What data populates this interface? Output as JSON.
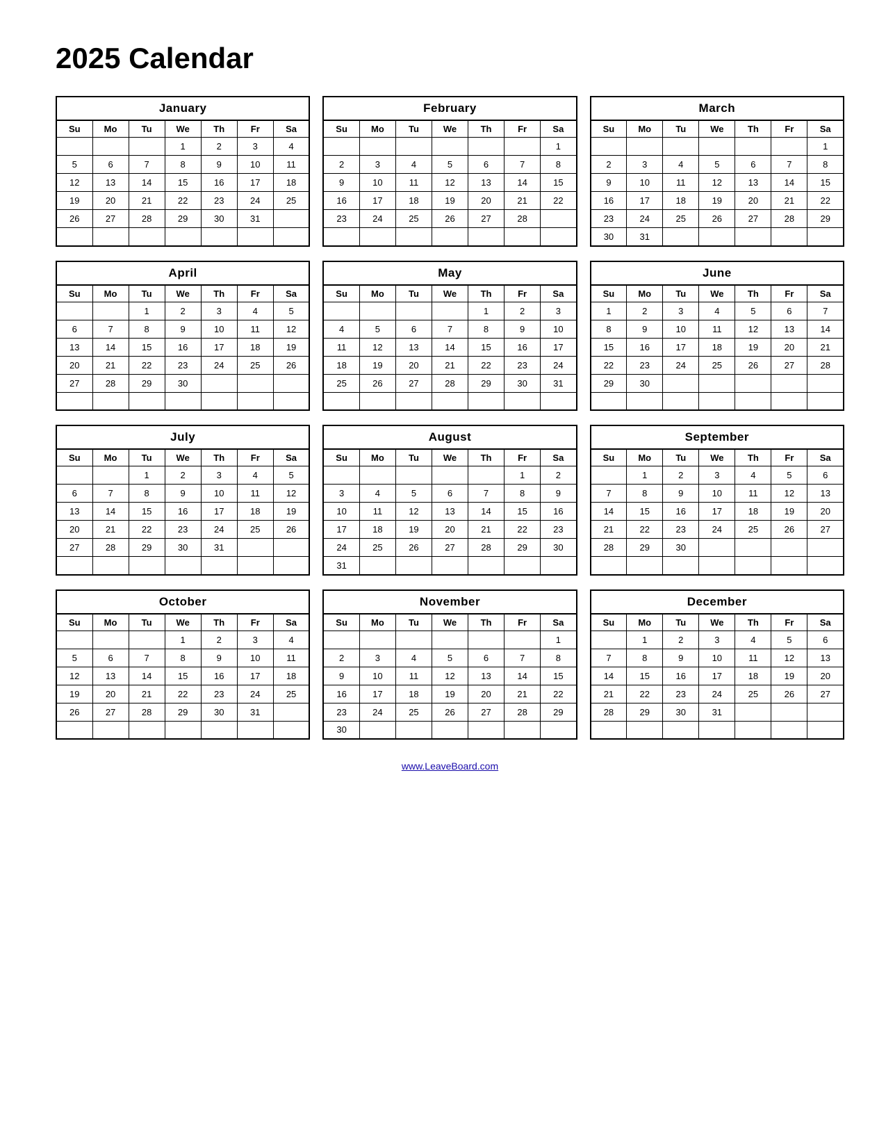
{
  "title": "2025 Calendar",
  "footer_link": "www.LeaveBoard.com",
  "days_header": [
    "Su",
    "Mo",
    "Tu",
    "We",
    "Th",
    "Fr",
    "Sa"
  ],
  "months": [
    {
      "name": "January",
      "weeks": [
        [
          "",
          "",
          "",
          "1",
          "2",
          "3",
          "4"
        ],
        [
          "5",
          "6",
          "7",
          "8",
          "9",
          "10",
          "11"
        ],
        [
          "12",
          "13",
          "14",
          "15",
          "16",
          "17",
          "18"
        ],
        [
          "19",
          "20",
          "21",
          "22",
          "23",
          "24",
          "25"
        ],
        [
          "26",
          "27",
          "28",
          "29",
          "30",
          "31",
          ""
        ],
        [
          "",
          "",
          "",
          "",
          "",
          "",
          ""
        ]
      ]
    },
    {
      "name": "February",
      "weeks": [
        [
          "",
          "",
          "",
          "",
          "",
          "",
          "1"
        ],
        [
          "2",
          "3",
          "4",
          "5",
          "6",
          "7",
          "8"
        ],
        [
          "9",
          "10",
          "11",
          "12",
          "13",
          "14",
          "15"
        ],
        [
          "16",
          "17",
          "18",
          "19",
          "20",
          "21",
          "22"
        ],
        [
          "23",
          "24",
          "25",
          "26",
          "27",
          "28",
          ""
        ],
        [
          "",
          "",
          "",
          "",
          "",
          "",
          ""
        ]
      ]
    },
    {
      "name": "March",
      "weeks": [
        [
          "",
          "",
          "",
          "",
          "",
          "",
          "1"
        ],
        [
          "2",
          "3",
          "4",
          "5",
          "6",
          "7",
          "8"
        ],
        [
          "9",
          "10",
          "11",
          "12",
          "13",
          "14",
          "15"
        ],
        [
          "16",
          "17",
          "18",
          "19",
          "20",
          "21",
          "22"
        ],
        [
          "23",
          "24",
          "25",
          "26",
          "27",
          "28",
          "29"
        ],
        [
          "30",
          "31",
          "",
          "",
          "",
          "",
          ""
        ]
      ]
    },
    {
      "name": "April",
      "weeks": [
        [
          "",
          "",
          "1",
          "2",
          "3",
          "4",
          "5"
        ],
        [
          "6",
          "7",
          "8",
          "9",
          "10",
          "11",
          "12"
        ],
        [
          "13",
          "14",
          "15",
          "16",
          "17",
          "18",
          "19"
        ],
        [
          "20",
          "21",
          "22",
          "23",
          "24",
          "25",
          "26"
        ],
        [
          "27",
          "28",
          "29",
          "30",
          "",
          "",
          ""
        ],
        [
          "",
          "",
          "",
          "",
          "",
          "",
          ""
        ]
      ]
    },
    {
      "name": "May",
      "weeks": [
        [
          "",
          "",
          "",
          "",
          "1",
          "2",
          "3"
        ],
        [
          "4",
          "5",
          "6",
          "7",
          "8",
          "9",
          "10"
        ],
        [
          "11",
          "12",
          "13",
          "14",
          "15",
          "16",
          "17"
        ],
        [
          "18",
          "19",
          "20",
          "21",
          "22",
          "23",
          "24"
        ],
        [
          "25",
          "26",
          "27",
          "28",
          "29",
          "30",
          "31"
        ],
        [
          "",
          "",
          "",
          "",
          "",
          "",
          ""
        ]
      ]
    },
    {
      "name": "June",
      "weeks": [
        [
          "1",
          "2",
          "3",
          "4",
          "5",
          "6",
          "7"
        ],
        [
          "8",
          "9",
          "10",
          "11",
          "12",
          "13",
          "14"
        ],
        [
          "15",
          "16",
          "17",
          "18",
          "19",
          "20",
          "21"
        ],
        [
          "22",
          "23",
          "24",
          "25",
          "26",
          "27",
          "28"
        ],
        [
          "29",
          "30",
          "",
          "",
          "",
          "",
          ""
        ],
        [
          "",
          "",
          "",
          "",
          "",
          "",
          ""
        ]
      ]
    },
    {
      "name": "July",
      "weeks": [
        [
          "",
          "",
          "1",
          "2",
          "3",
          "4",
          "5"
        ],
        [
          "6",
          "7",
          "8",
          "9",
          "10",
          "11",
          "12"
        ],
        [
          "13",
          "14",
          "15",
          "16",
          "17",
          "18",
          "19"
        ],
        [
          "20",
          "21",
          "22",
          "23",
          "24",
          "25",
          "26"
        ],
        [
          "27",
          "28",
          "29",
          "30",
          "31",
          "",
          ""
        ],
        [
          "",
          "",
          "",
          "",
          "",
          "",
          ""
        ]
      ]
    },
    {
      "name": "August",
      "weeks": [
        [
          "",
          "",
          "",
          "",
          "",
          "1",
          "2"
        ],
        [
          "3",
          "4",
          "5",
          "6",
          "7",
          "8",
          "9"
        ],
        [
          "10",
          "11",
          "12",
          "13",
          "14",
          "15",
          "16"
        ],
        [
          "17",
          "18",
          "19",
          "20",
          "21",
          "22",
          "23"
        ],
        [
          "24",
          "25",
          "26",
          "27",
          "28",
          "29",
          "30"
        ],
        [
          "31",
          "",
          "",
          "",
          "",
          "",
          ""
        ]
      ]
    },
    {
      "name": "September",
      "weeks": [
        [
          "",
          "1",
          "2",
          "3",
          "4",
          "5",
          "6"
        ],
        [
          "7",
          "8",
          "9",
          "10",
          "11",
          "12",
          "13"
        ],
        [
          "14",
          "15",
          "16",
          "17",
          "18",
          "19",
          "20"
        ],
        [
          "21",
          "22",
          "23",
          "24",
          "25",
          "26",
          "27"
        ],
        [
          "28",
          "29",
          "30",
          "",
          "",
          "",
          ""
        ],
        [
          "",
          "",
          "",
          "",
          "",
          "",
          ""
        ]
      ]
    },
    {
      "name": "October",
      "weeks": [
        [
          "",
          "",
          "",
          "1",
          "2",
          "3",
          "4"
        ],
        [
          "5",
          "6",
          "7",
          "8",
          "9",
          "10",
          "11"
        ],
        [
          "12",
          "13",
          "14",
          "15",
          "16",
          "17",
          "18"
        ],
        [
          "19",
          "20",
          "21",
          "22",
          "23",
          "24",
          "25"
        ],
        [
          "26",
          "27",
          "28",
          "29",
          "30",
          "31",
          ""
        ],
        [
          "",
          "",
          "",
          "",
          "",
          "",
          ""
        ]
      ]
    },
    {
      "name": "November",
      "weeks": [
        [
          "",
          "",
          "",
          "",
          "",
          "",
          "1"
        ],
        [
          "2",
          "3",
          "4",
          "5",
          "6",
          "7",
          "8"
        ],
        [
          "9",
          "10",
          "11",
          "12",
          "13",
          "14",
          "15"
        ],
        [
          "16",
          "17",
          "18",
          "19",
          "20",
          "21",
          "22"
        ],
        [
          "23",
          "24",
          "25",
          "26",
          "27",
          "28",
          "29"
        ],
        [
          "30",
          "",
          "",
          "",
          "",
          "",
          ""
        ]
      ]
    },
    {
      "name": "December",
      "weeks": [
        [
          "",
          "1",
          "2",
          "3",
          "4",
          "5",
          "6"
        ],
        [
          "7",
          "8",
          "9",
          "10",
          "11",
          "12",
          "13"
        ],
        [
          "14",
          "15",
          "16",
          "17",
          "18",
          "19",
          "20"
        ],
        [
          "21",
          "22",
          "23",
          "24",
          "25",
          "26",
          "27"
        ],
        [
          "28",
          "29",
          "30",
          "31",
          "",
          "",
          ""
        ],
        [
          "",
          "",
          "",
          "",
          "",
          "",
          ""
        ]
      ]
    }
  ]
}
